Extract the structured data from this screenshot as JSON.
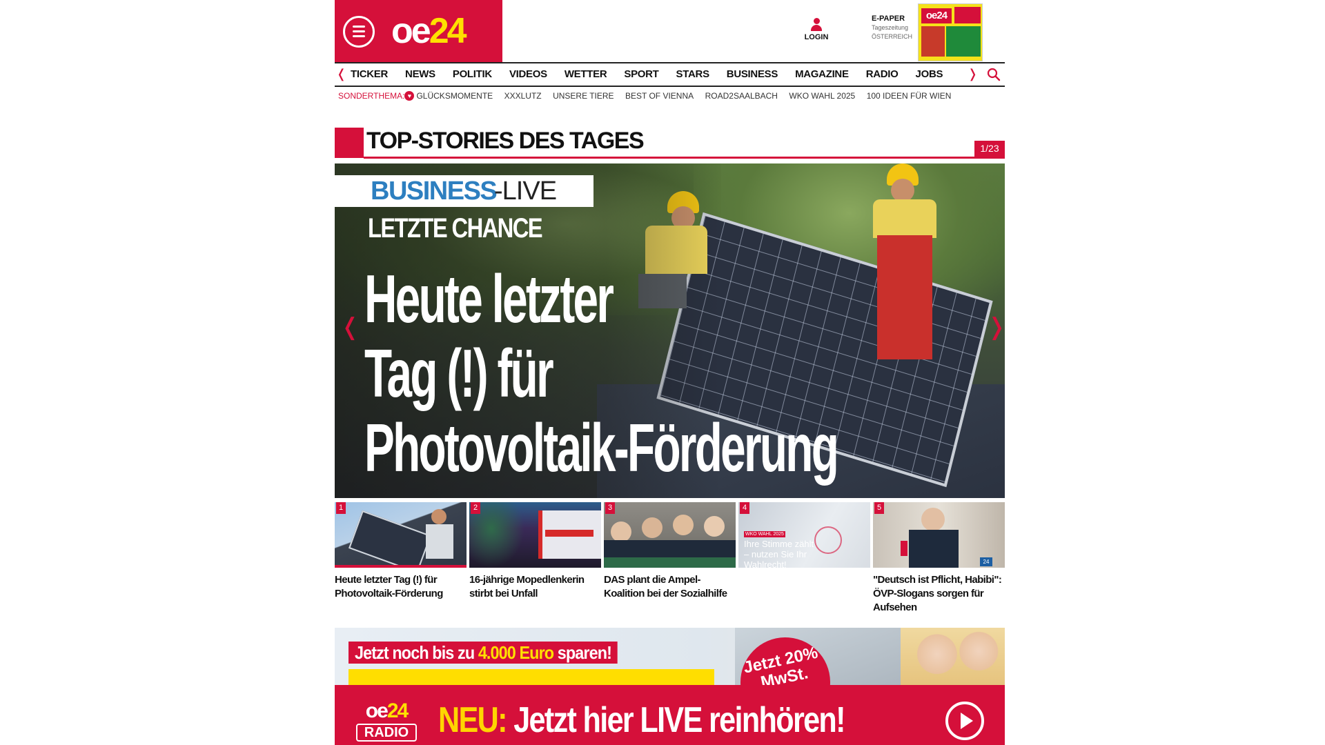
{
  "header": {
    "logo_main": "oe",
    "logo_accent": "24",
    "login_label": "LOGIN",
    "epaper_title": "E-PAPER",
    "epaper_sub1": "Tageszeitung",
    "epaper_sub2": "ÖSTERREICH",
    "epaper_thumb_logo": "oe24"
  },
  "nav": {
    "items": [
      "TICKER",
      "NEWS",
      "POLITIK",
      "VIDEOS",
      "WETTER",
      "SPORT",
      "STARS",
      "BUSINESS",
      "MAGAZINE",
      "RADIO",
      "JOBS"
    ],
    "prev_arrow": "❬",
    "next_arrow": "❭"
  },
  "sub_nav": {
    "label": "SONDERTHEMA:",
    "items": [
      "GLÜCKSMOMENTE",
      "XXXLUTZ",
      "UNSERE TIERE",
      "BEST OF VIENNA",
      "ROAD2SAALBACH",
      "WKO WAHL 2025",
      "100 IDEEN FÜR WIEN"
    ]
  },
  "section": {
    "title": "TOP-STORIES DES TAGES",
    "counter": "1/23"
  },
  "hero": {
    "badge_business": "BUSINESS",
    "badge_live": "-LIVE",
    "kicker": "LETZTE CHANCE",
    "headline_lines": [
      "Heute letzter",
      "Tag (!) für",
      "Photovoltaik-Förderung"
    ],
    "prev_arrow": "❬",
    "next_arrow": "❭"
  },
  "thumbnails": [
    {
      "num": "1",
      "caption": "Heute letzter Tag (!) für Photovoltaik-Förderung",
      "active": true
    },
    {
      "num": "2",
      "caption": "16-jährige Mopedlenkerin stirbt bei Unfall",
      "active": false
    },
    {
      "num": "3",
      "caption": "DAS plant die Ampel-Koalition bei der Sozialhilfe",
      "active": false
    },
    {
      "num": "4",
      "caption": "",
      "active": false,
      "overlay_tag": "WKO WAHL 2025",
      "overlay_text": "Ihre Stimme zählt – nutzen Sie Ihr Wahlrecht!"
    },
    {
      "num": "5",
      "caption": "\"Deutsch ist Pflicht, Habibi\": ÖVP-Slogans sorgen für Aufsehen",
      "active": false
    }
  ],
  "ad": {
    "label_prefix": "Jetzt noch bis zu ",
    "label_amount": "4.000 Euro",
    "label_suffix": " sparen!",
    "circle_text": "Jetzt 20% MwSt."
  },
  "radio": {
    "logo_main": "oe",
    "logo_accent": "24",
    "logo_sub": "RADIO",
    "text_neu": "NEU:",
    "text_main": " Jetzt hier LIVE reinhören!"
  },
  "colors": {
    "brand_red": "#d5103a",
    "accent_yellow": "#ffe000",
    "business_blue": "#2d7fc0"
  }
}
